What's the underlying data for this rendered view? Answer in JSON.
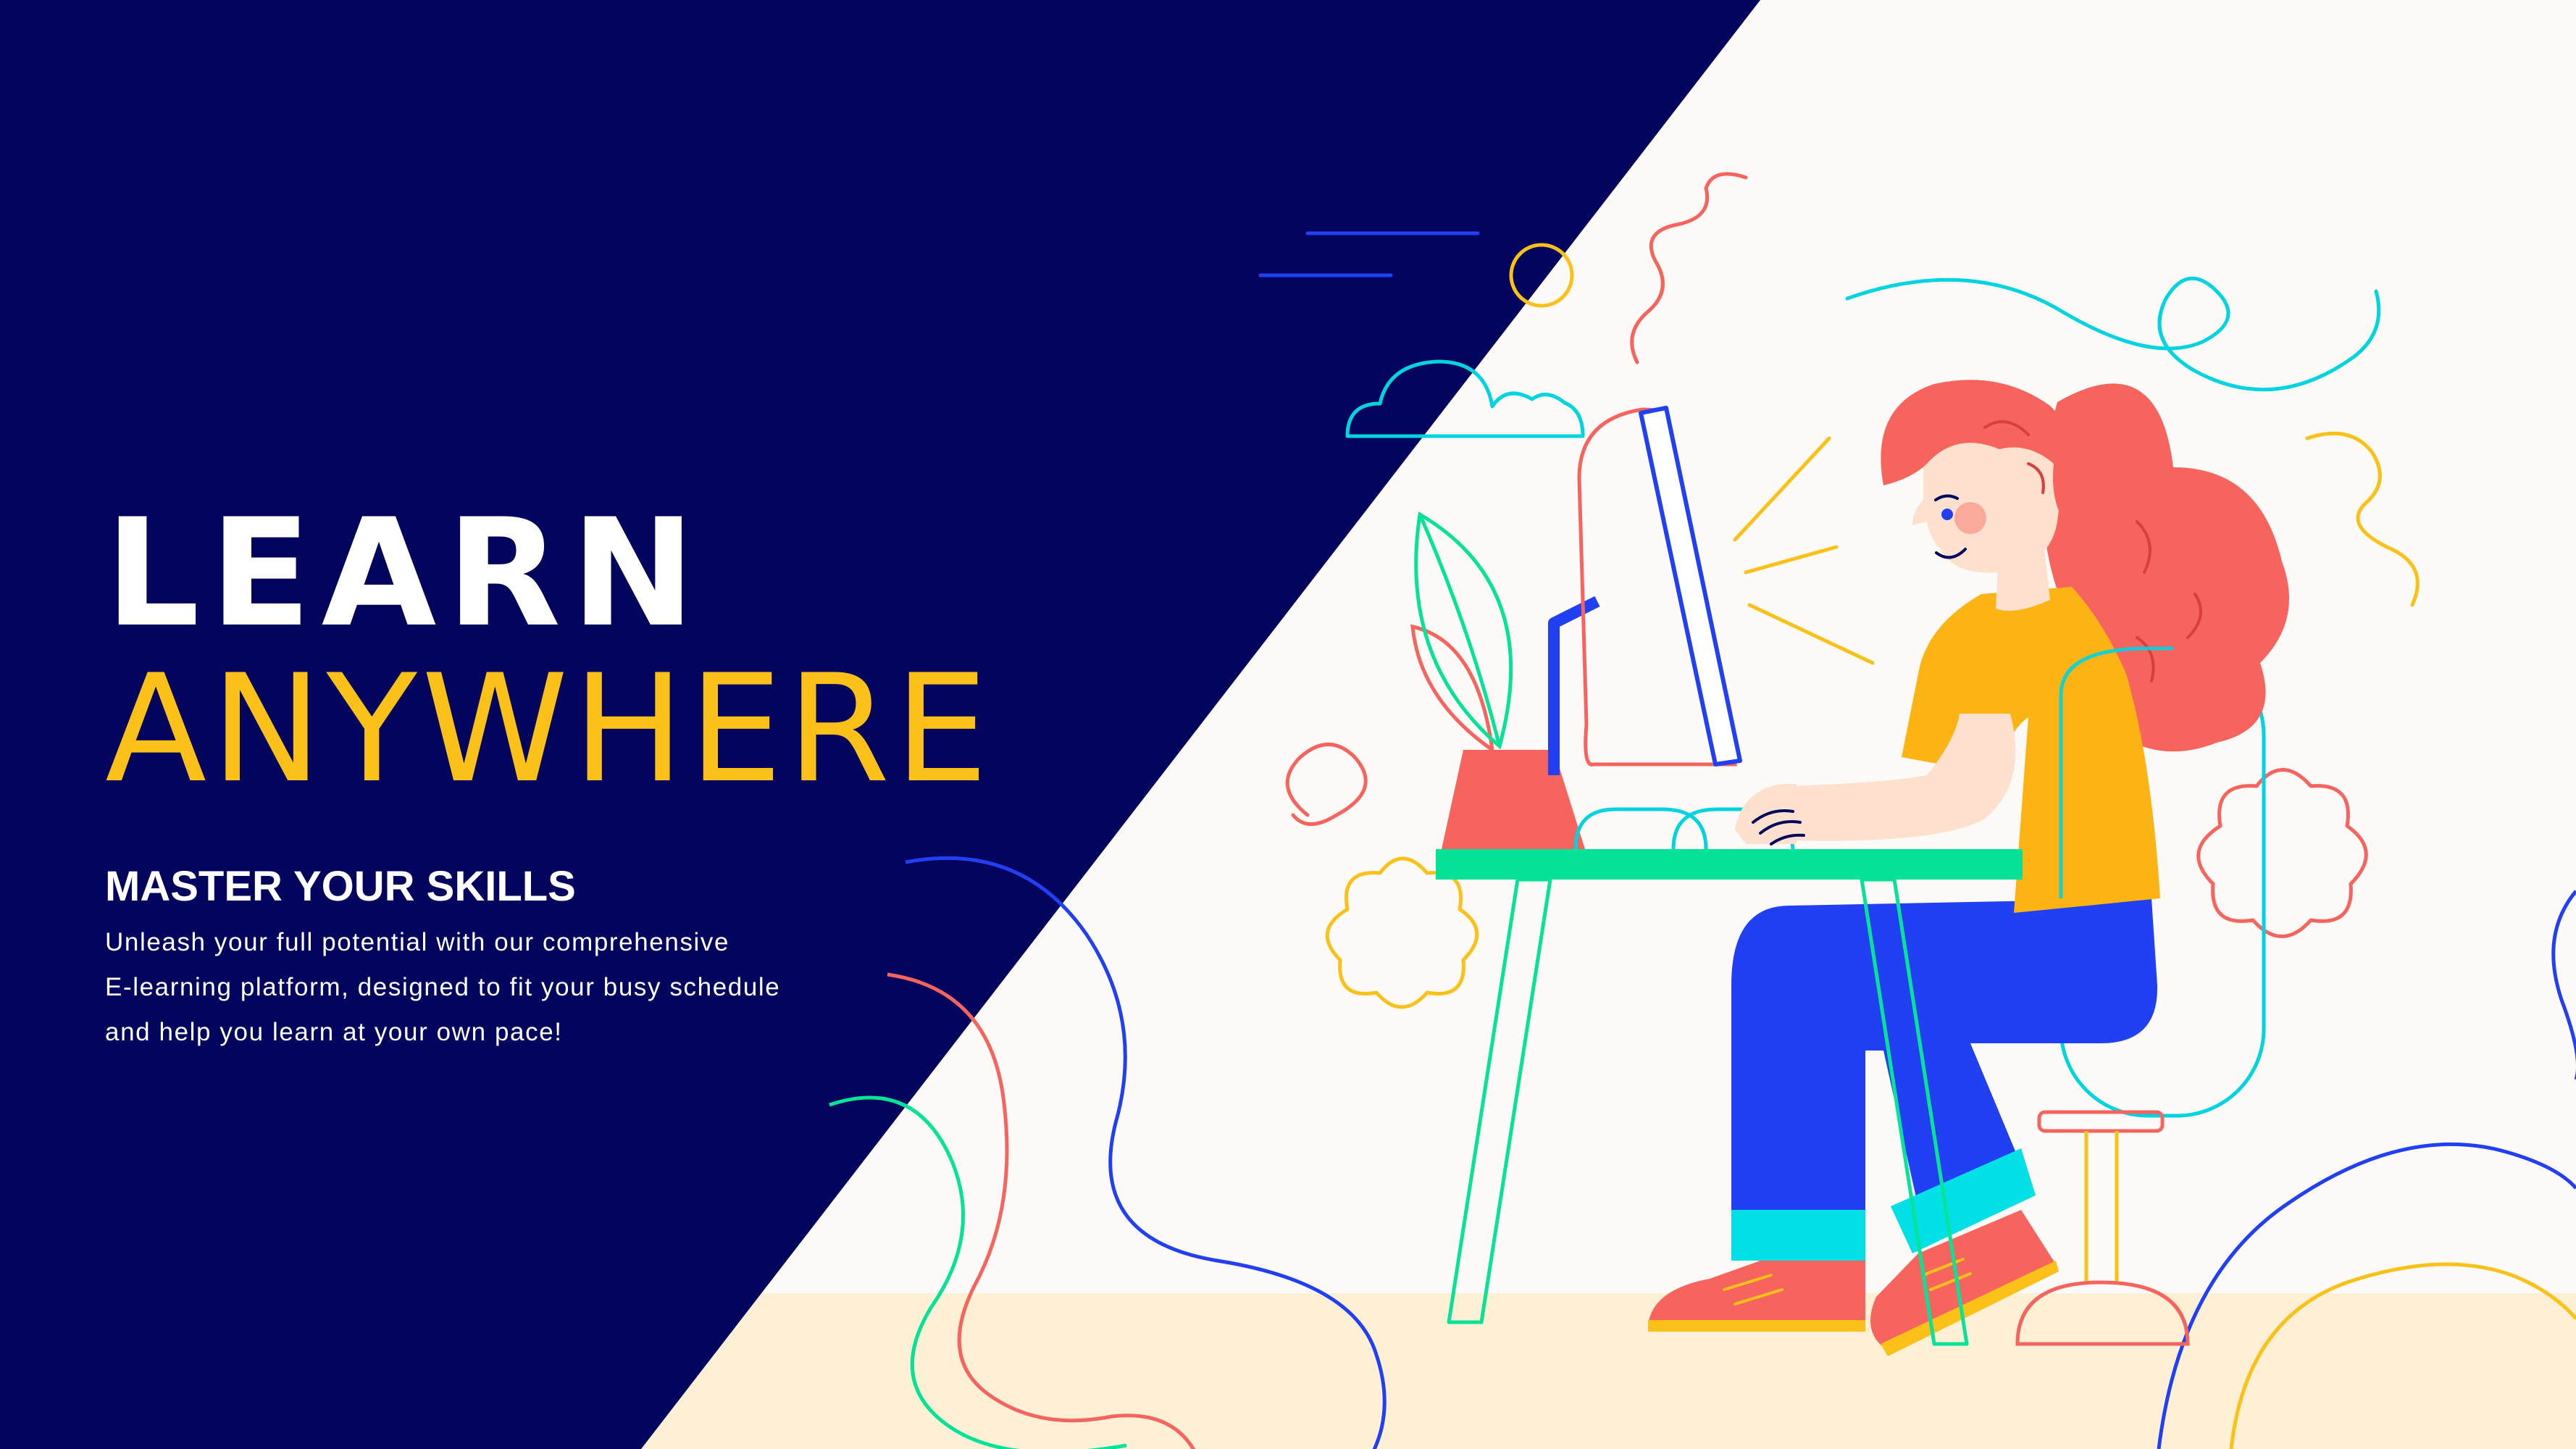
{
  "hero": {
    "headline_line1": "LEARN",
    "headline_line2": "ANYWHERE",
    "subheading": "MASTER YOUR SKILLS",
    "body_lines": [
      "Unleash your full potential with our comprehensive",
      "E-learning platform, designed to fit your busy schedule",
      "and help you learn at your own pace!"
    ]
  },
  "colors": {
    "navy_panel": "#03045e",
    "accent_yellow": "#fcc119",
    "light_background": "#fdfaf8",
    "floor": "#fdf0d5",
    "hair_coral": "#f7645e",
    "pants_blue": "#2140f3",
    "desk_green": "#06e399"
  },
  "illustration": {
    "icons": [
      "woman-at-desk-illustration",
      "computer-monitor-icon",
      "potted-plant-icon",
      "cloud-icon",
      "flower-outline-icon"
    ]
  }
}
